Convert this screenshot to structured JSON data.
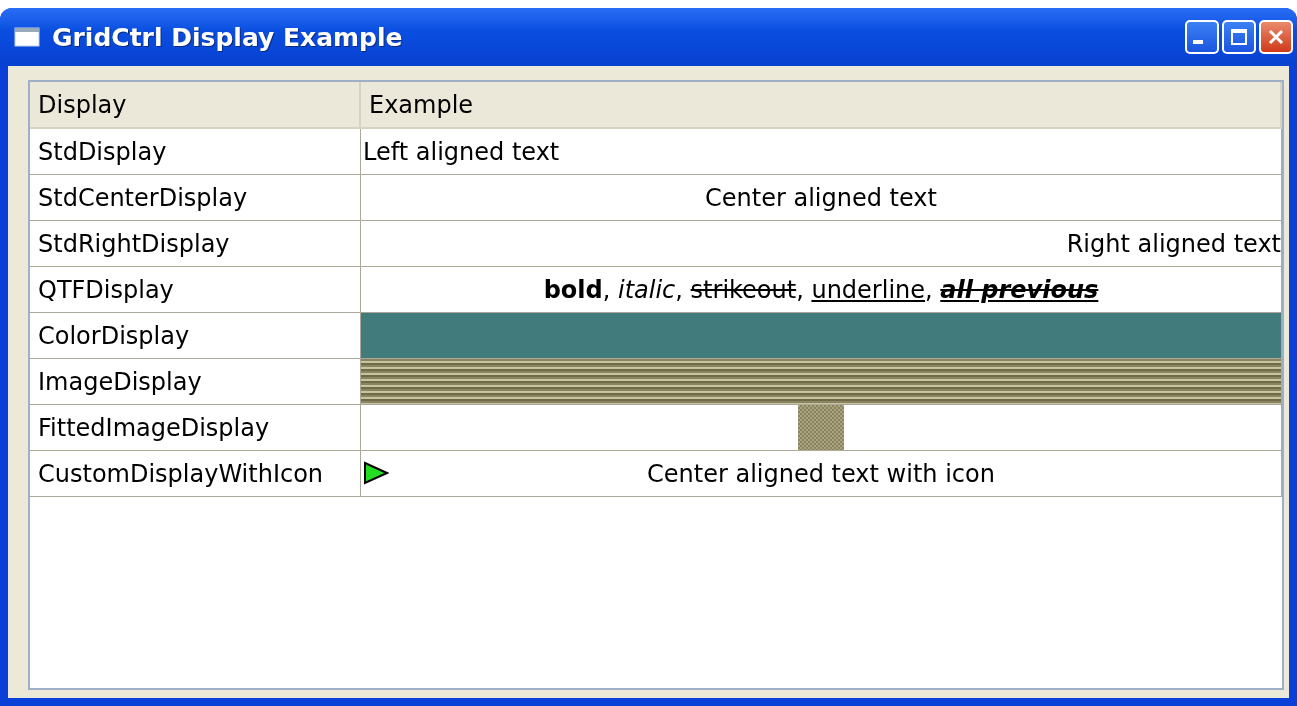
{
  "window": {
    "title": "GridCtrl Display Example"
  },
  "table": {
    "columns": [
      "Display",
      "Example"
    ],
    "rows": [
      {
        "name": "StdDisplay",
        "kind": "left_text",
        "text": "Left aligned text"
      },
      {
        "name": "StdCenterDisplay",
        "kind": "center_text",
        "text": "Center aligned text"
      },
      {
        "name": "StdRightDisplay",
        "kind": "right_text",
        "text": "Right aligned text"
      },
      {
        "name": "QTFDisplay",
        "kind": "rich",
        "segments": [
          {
            "text": "bold",
            "bold": true,
            "italic": false,
            "strikeout": false,
            "underline": false
          },
          {
            "text": ", ",
            "bold": false,
            "italic": false,
            "strikeout": false,
            "underline": false
          },
          {
            "text": "italic",
            "bold": false,
            "italic": true,
            "strikeout": false,
            "underline": false
          },
          {
            "text": ", ",
            "bold": false,
            "italic": false,
            "strikeout": false,
            "underline": false
          },
          {
            "text": "strikeout",
            "bold": false,
            "italic": false,
            "strikeout": true,
            "underline": false
          },
          {
            "text": ", ",
            "bold": false,
            "italic": false,
            "strikeout": false,
            "underline": false
          },
          {
            "text": "underline",
            "bold": false,
            "italic": false,
            "strikeout": false,
            "underline": true
          },
          {
            "text": ", ",
            "bold": false,
            "italic": false,
            "strikeout": false,
            "underline": false
          },
          {
            "text": "all previous",
            "bold": true,
            "italic": true,
            "strikeout": true,
            "underline": true
          }
        ]
      },
      {
        "name": "ColorDisplay",
        "kind": "color",
        "color": "#417b7b"
      },
      {
        "name": "ImageDisplay"
      },
      {
        "name": "FittedImageDisplay",
        "kind": "fitted_image"
      },
      {
        "name": "CustomDisplayWithIcon",
        "kind": "icon_text",
        "text": "Center aligned text with icon"
      }
    ]
  }
}
